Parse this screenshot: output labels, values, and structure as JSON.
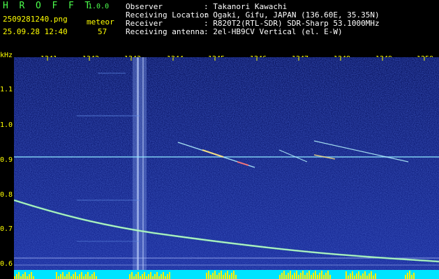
{
  "app": {
    "title_letters": [
      "H",
      "R",
      "O",
      "F",
      "F",
      "T"
    ],
    "version": "1.0.0",
    "filename": "2509281240.png",
    "datetime": "25.09.28 12:40",
    "meteor_label": "meteor",
    "meteor_count": "57"
  },
  "info": [
    {
      "label": "Observer",
      "value": ": Takanori Kawachi"
    },
    {
      "label": "Receiving Location",
      "value": ": Ogaki, Gifu, JAPAN (136.60E, 35.35N)"
    },
    {
      "label": "Receiver",
      "value": ": R820T2(RTL-SDR) SDR-Sharp 53.1000MHz"
    },
    {
      "label": "Receiving antenna",
      "value": ": 2el-HB9CV Vertical (el. E-W)"
    }
  ],
  "axis": {
    "y_unit": "kHz",
    "y_ticks": [
      "1.1",
      "1.0",
      "0.9",
      "0.8",
      "0.7",
      "0.6"
    ],
    "x_ticks": [
      "1241",
      "1242",
      "1243",
      "1244",
      "1245",
      "1246",
      "1247",
      "1248",
      "1249",
      "1250"
    ]
  },
  "colors": {
    "background": "#000000",
    "label_yellow": "#ffff00",
    "title_green": "#4cff4c",
    "info_white": "#ffffff",
    "spectrum_blue": "#10208a",
    "signal_cyan": "#9ff4ff",
    "audio_bar_yellow": "#ffee00",
    "audio_bar_cyan": "#00e4ff"
  }
}
